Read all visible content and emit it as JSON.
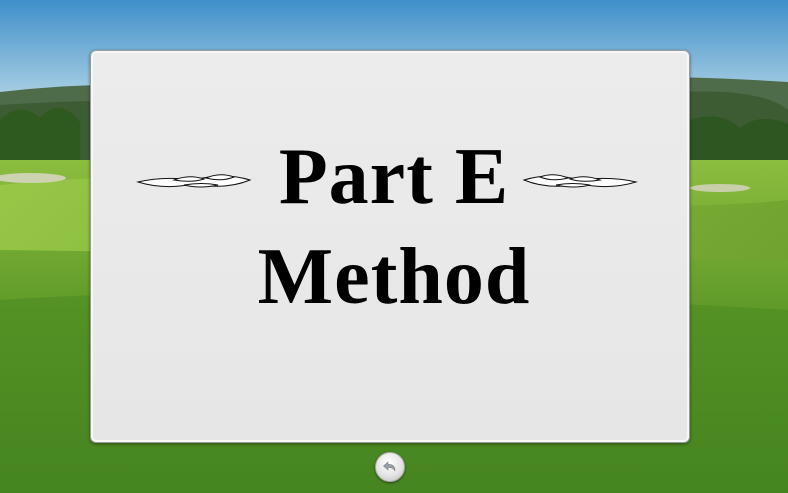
{
  "slide": {
    "title_line1": "Part E",
    "title_line2": "Method"
  },
  "controls": {
    "back_icon": "return-arrow-icon"
  },
  "colors": {
    "sky_top": "#3f8fc9",
    "sky_bottom": "#cfe4ee",
    "grass_light": "#7fb238",
    "grass_dark": "#3c7a1c",
    "card_bg": "#e8e8e8",
    "title_text": "#000000"
  }
}
